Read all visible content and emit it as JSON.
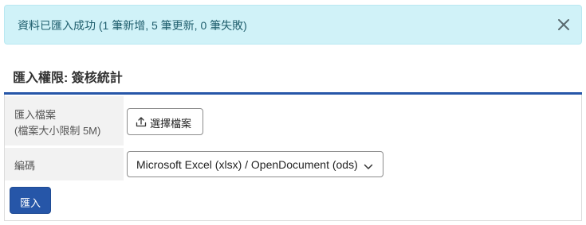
{
  "alert": {
    "message": "資料已匯入成功 (1 筆新增, 5 筆更新, 0 筆失敗)",
    "close_icon": "close-icon"
  },
  "panel": {
    "title": "匯入權限: 簽核統計",
    "accent_color": "#2656a8"
  },
  "form": {
    "file_label_line1": "匯入檔案",
    "file_label_line2": "(檔案大小限制 5M)",
    "file_button_label": "選擇檔案",
    "file_button_icon": "upload-icon",
    "encoding_label": "編碼",
    "encoding_selected": "Microsoft Excel (xlsx) / OpenDocument (ods)",
    "encoding_chevron_icon": "chevron-down-icon",
    "submit_label": "匯入"
  }
}
